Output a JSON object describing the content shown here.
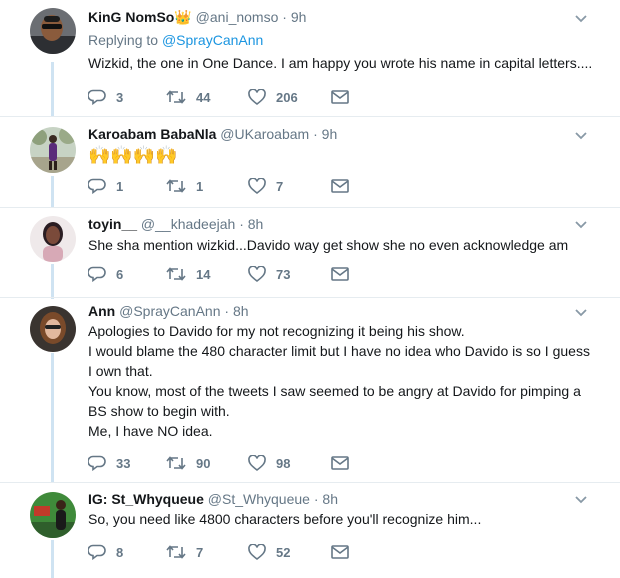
{
  "tweets": [
    {
      "name": "KinG NomSo",
      "name_emoji": "👑",
      "handle": "@ani_nomso",
      "time": "9h",
      "reply_prefix": "Replying to ",
      "reply_to": "@SprayCanAnn",
      "lines": [
        "Wizkid, the one in One Dance. I am happy you wrote his name in capital letters...."
      ],
      "replies": "3",
      "retweets": "44",
      "likes": "206"
    },
    {
      "name": "Karoabam BabaNla",
      "handle": "@UKaroabam",
      "time": "9h",
      "emoji_body": "🙌🙌🙌🙌",
      "replies": "1",
      "retweets": "1",
      "likes": "7"
    },
    {
      "name": "toyin__",
      "handle": "@__khadeejah",
      "time": "8h",
      "lines": [
        "She sha mention wizkid...Davido way get show she no even acknowledge am"
      ],
      "replies": "6",
      "retweets": "14",
      "likes": "73"
    },
    {
      "name": "Ann",
      "handle": "@SprayCanAnn",
      "time": "8h",
      "lines": [
        "Apologies to Davido for my not recognizing it being his show.",
        "I would blame the 480 character limit but I have no idea who Davido is so I guess",
        "I own that.",
        "You know, most of the tweets I saw seemed to be angry at Davido for pimping a",
        "BS show to begin with.",
        "Me, I have NO idea."
      ],
      "replies": "33",
      "retweets": "90",
      "likes": "98"
    },
    {
      "name": "IG: St_Whyqueue",
      "handle": "@St_Whyqueue",
      "time": "8h",
      "lines": [
        "So, you need like 4800 characters before you'll recognize him..."
      ],
      "replies": "8",
      "retweets": "7",
      "likes": "52"
    }
  ],
  "separator": "·",
  "colors": {
    "link": "#1b95e0",
    "muted": "#657786",
    "text": "#14171a",
    "thread": "#cfe3f2",
    "divider": "#e6ecf0"
  }
}
